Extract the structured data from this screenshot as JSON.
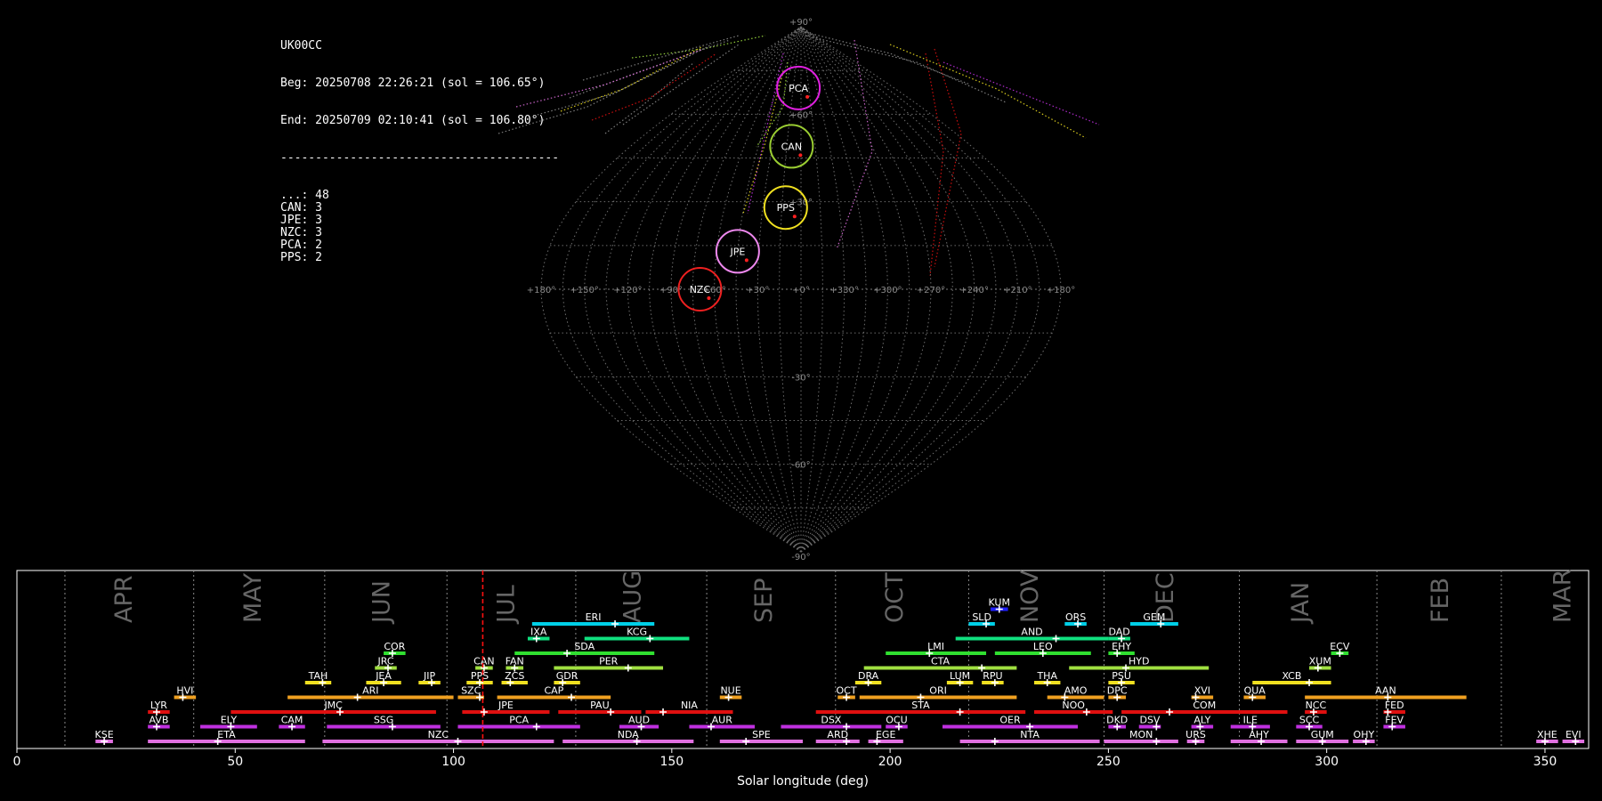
{
  "info": {
    "station": "UK00CC",
    "begin": "Beg: 20250708 22:26:21 (sol = 106.65°)",
    "end": "End: 20250709 02:10:41 (sol = 106.80°)",
    "separator": "----------------------------------------",
    "counts": [
      {
        "code": "...",
        "count": 48
      },
      {
        "code": "CAN",
        "count": 3
      },
      {
        "code": "JPE",
        "count": 3
      },
      {
        "code": "NZC",
        "count": 3
      },
      {
        "code": "PCA",
        "count": 2
      },
      {
        "code": "PPS",
        "count": 2
      }
    ]
  },
  "colors": {
    "PCA": "#e020e0",
    "CAN": "#9acd32",
    "PPS": "#f0e020",
    "JPE": "#ee88ee",
    "NZC": "#ee2020",
    "gray": "#888888",
    "red": "#e01010",
    "orange": "#f0a020",
    "yellow": "#f0e020",
    "green": "#a0e040",
    "lime": "#30e030",
    "cyan": "#00d0e8",
    "teal": "#10e080",
    "magenta": "#c030e0",
    "pink": "#e070e0",
    "blue": "#2020ff",
    "marker": "#ff2020"
  },
  "chart_data": [
    {
      "type": "scatter",
      "projection": "sinusoidal (radiant sky map)",
      "lon_ticks": [
        "+180°",
        "+150°",
        "+120°",
        "+90°",
        "+60°",
        "+30°",
        "+0°",
        "+330°",
        "+300°",
        "+270°",
        "+240°",
        "+210°",
        "+180°"
      ],
      "lat_ticks": [
        "+90°",
        "+60°",
        "+30°",
        "-30°",
        "-60°",
        "-90°"
      ],
      "radiants": [
        {
          "code": "PCA",
          "lon": -5,
          "lat": 69
        },
        {
          "code": "CAN",
          "lon": -10,
          "lat": 49
        },
        {
          "code": "PPS",
          "lon": -12,
          "lat": 28
        },
        {
          "code": "JPE",
          "lon": -45,
          "lat": 13
        },
        {
          "code": "NZC",
          "lon": -70,
          "lat": 0
        }
      ]
    },
    {
      "type": "bar",
      "xlabel": "Solar longitude (deg)",
      "xlim": [
        0,
        360
      ],
      "x_ticks": [
        0,
        50,
        100,
        150,
        200,
        250,
        300,
        350
      ],
      "current_sol": 106.7,
      "months": [
        {
          "label": "APR",
          "at": 24.5,
          "start": 11
        },
        {
          "label": "MAY",
          "at": 54,
          "start": 40.5
        },
        {
          "label": "JUN",
          "at": 83.5,
          "start": 70.5
        },
        {
          "label": "JUL",
          "at": 112,
          "start": 98.5
        },
        {
          "label": "AUG",
          "at": 141,
          "start": 128
        },
        {
          "label": "SEP",
          "at": 171,
          "start": 158
        },
        {
          "label": "OCT",
          "at": 201,
          "start": 187.5
        },
        {
          "label": "NOV",
          "at": 232,
          "start": 218
        },
        {
          "label": "DEC",
          "at": 263,
          "start": 249
        },
        {
          "label": "JAN",
          "at": 294,
          "start": 280
        },
        {
          "label": "FEB",
          "at": 326,
          "start": 311.5
        },
        {
          "label": "MAR",
          "at": 354,
          "start": 340
        }
      ],
      "showers": [
        {
          "code": "KUM",
          "start": 223,
          "end": 227,
          "peak": 225,
          "row": 9,
          "color": "blue"
        },
        {
          "code": "ERI",
          "start": 118,
          "end": 146,
          "peak": 137,
          "row": 8,
          "color": "cyan"
        },
        {
          "code": "SLD",
          "start": 218,
          "end": 224,
          "peak": 222,
          "row": 8,
          "color": "cyan"
        },
        {
          "code": "ORS",
          "start": 240,
          "end": 245,
          "peak": 243,
          "row": 8,
          "color": "cyan"
        },
        {
          "code": "GEM",
          "start": 255,
          "end": 266,
          "peak": 262,
          "row": 8,
          "color": "cyan"
        },
        {
          "code": "IXA",
          "start": 117,
          "end": 122,
          "peak": 119,
          "row": 7,
          "color": "teal"
        },
        {
          "code": "KCG",
          "start": 130,
          "end": 154,
          "peak": 145,
          "row": 7,
          "color": "teal"
        },
        {
          "code": "AND",
          "start": 215,
          "end": 250,
          "peak": 238,
          "row": 7,
          "color": "teal"
        },
        {
          "code": "DAD",
          "start": 250,
          "end": 255,
          "peak": 253,
          "row": 7,
          "color": "teal"
        },
        {
          "code": "COR",
          "start": 84,
          "end": 89,
          "peak": 86,
          "row": 6,
          "color": "lime"
        },
        {
          "code": "SDA",
          "start": 114,
          "end": 146,
          "peak": 126,
          "row": 6,
          "color": "lime"
        },
        {
          "code": "LMI",
          "start": 199,
          "end": 222,
          "peak": 209,
          "row": 6,
          "color": "lime"
        },
        {
          "code": "LEO",
          "start": 224,
          "end": 246,
          "peak": 235,
          "row": 6,
          "color": "lime"
        },
        {
          "code": "EHY",
          "start": 250,
          "end": 256,
          "peak": 252,
          "row": 6,
          "color": "lime"
        },
        {
          "code": "ECV",
          "start": 301,
          "end": 305,
          "peak": 303,
          "row": 6,
          "color": "lime"
        },
        {
          "code": "JRC",
          "start": 82,
          "end": 87,
          "peak": 85,
          "row": 5,
          "color": "green"
        },
        {
          "code": "CAN",
          "start": 105,
          "end": 109,
          "peak": 107,
          "row": 5,
          "color": "green"
        },
        {
          "code": "FAN",
          "start": 112,
          "end": 116,
          "peak": 114,
          "row": 5,
          "color": "green"
        },
        {
          "code": "PER",
          "start": 123,
          "end": 148,
          "peak": 140,
          "row": 5,
          "color": "green"
        },
        {
          "code": "CTA",
          "start": 194,
          "end": 229,
          "peak": 221,
          "row": 5,
          "color": "green"
        },
        {
          "code": "HYD",
          "start": 241,
          "end": 273,
          "peak": 254,
          "row": 5,
          "color": "green"
        },
        {
          "code": "XUM",
          "start": 296,
          "end": 301,
          "peak": 298,
          "row": 5,
          "color": "green"
        },
        {
          "code": "TAH",
          "start": 66,
          "end": 72,
          "peak": 70,
          "row": 4,
          "color": "yellow"
        },
        {
          "code": "JEA",
          "start": 80,
          "end": 88,
          "peak": 84,
          "row": 4,
          "color": "yellow"
        },
        {
          "code": "JIP",
          "start": 92,
          "end": 97,
          "peak": 95,
          "row": 4,
          "color": "yellow"
        },
        {
          "code": "PPS",
          "start": 103,
          "end": 109,
          "peak": 106,
          "row": 4,
          "color": "yellow"
        },
        {
          "code": "ZCS",
          "start": 111,
          "end": 117,
          "peak": 113,
          "row": 4,
          "color": "yellow"
        },
        {
          "code": "GDR",
          "start": 123,
          "end": 129,
          "peak": 125,
          "row": 4,
          "color": "yellow"
        },
        {
          "code": "DRA",
          "start": 192,
          "end": 198,
          "peak": 195,
          "row": 4,
          "color": "yellow"
        },
        {
          "code": "LUM",
          "start": 213,
          "end": 219,
          "peak": 216,
          "row": 4,
          "color": "yellow"
        },
        {
          "code": "RPU",
          "start": 221,
          "end": 226,
          "peak": 224,
          "row": 4,
          "color": "yellow"
        },
        {
          "code": "THA",
          "start": 233,
          "end": 239,
          "peak": 236,
          "row": 4,
          "color": "yellow"
        },
        {
          "code": "PSU",
          "start": 250,
          "end": 256,
          "peak": 253,
          "row": 4,
          "color": "yellow"
        },
        {
          "code": "XCB",
          "start": 283,
          "end": 301,
          "peak": 296,
          "row": 4,
          "color": "yellow"
        },
        {
          "code": "HVI",
          "start": 36,
          "end": 41,
          "peak": 38,
          "row": 3,
          "color": "orange"
        },
        {
          "code": "ARI",
          "start": 62,
          "end": 100,
          "peak": 78,
          "row": 3,
          "color": "orange"
        },
        {
          "code": "SZC",
          "start": 101,
          "end": 107,
          "peak": 106,
          "row": 3,
          "color": "orange"
        },
        {
          "code": "CAP",
          "start": 110,
          "end": 136,
          "peak": 127,
          "row": 3,
          "color": "orange"
        },
        {
          "code": "NUE",
          "start": 161,
          "end": 166,
          "peak": 163,
          "row": 3,
          "color": "orange"
        },
        {
          "code": "OCT",
          "start": 188,
          "end": 192,
          "peak": 190,
          "row": 3,
          "color": "orange"
        },
        {
          "code": "ORI",
          "start": 193,
          "end": 229,
          "peak": 207,
          "row": 3,
          "color": "orange"
        },
        {
          "code": "AMO",
          "start": 236,
          "end": 249,
          "peak": 240,
          "row": 3,
          "color": "orange"
        },
        {
          "code": "DPC",
          "start": 250,
          "end": 254,
          "peak": 252,
          "row": 3,
          "color": "orange"
        },
        {
          "code": "XVI",
          "start": 269,
          "end": 274,
          "peak": 270,
          "row": 3,
          "color": "orange"
        },
        {
          "code": "QUA",
          "start": 281,
          "end": 286,
          "peak": 283,
          "row": 3,
          "color": "orange"
        },
        {
          "code": "AAN",
          "start": 295,
          "end": 332,
          "peak": 314,
          "row": 3,
          "color": "orange"
        },
        {
          "code": "LYR",
          "start": 30,
          "end": 35,
          "peak": 32,
          "row": 2,
          "color": "red"
        },
        {
          "code": "JMC",
          "start": 49,
          "end": 96,
          "peak": 74,
          "row": 2,
          "color": "red"
        },
        {
          "code": "JPE",
          "start": 102,
          "end": 122,
          "peak": 107,
          "row": 2,
          "color": "red"
        },
        {
          "code": "PAU",
          "start": 124,
          "end": 143,
          "peak": 136,
          "row": 2,
          "color": "red"
        },
        {
          "code": "NIA",
          "start": 144,
          "end": 164,
          "peak": 148,
          "row": 2,
          "color": "red"
        },
        {
          "code": "STA",
          "start": 183,
          "end": 231,
          "peak": 216,
          "row": 2,
          "color": "red"
        },
        {
          "code": "NOO",
          "start": 233,
          "end": 251,
          "peak": 245,
          "row": 2,
          "color": "red"
        },
        {
          "code": "COM",
          "start": 253,
          "end": 291,
          "peak": 264,
          "row": 2,
          "color": "red"
        },
        {
          "code": "NCC",
          "start": 295,
          "end": 300,
          "peak": 297,
          "row": 2,
          "color": "red"
        },
        {
          "code": "FED",
          "start": 313,
          "end": 318,
          "peak": 314,
          "row": 2,
          "color": "red"
        },
        {
          "code": "AVB",
          "start": 30,
          "end": 35,
          "peak": 32,
          "row": 1,
          "color": "magenta"
        },
        {
          "code": "ELY",
          "start": 42,
          "end": 55,
          "peak": 49,
          "row": 1,
          "color": "magenta"
        },
        {
          "code": "CAM",
          "start": 60,
          "end": 66,
          "peak": 63,
          "row": 1,
          "color": "magenta"
        },
        {
          "code": "SSG",
          "start": 71,
          "end": 97,
          "peak": 86,
          "row": 1,
          "color": "magenta"
        },
        {
          "code": "PCA",
          "start": 101,
          "end": 129,
          "peak": 119,
          "row": 1,
          "color": "magenta"
        },
        {
          "code": "AUD",
          "start": 138,
          "end": 147,
          "peak": 143,
          "row": 1,
          "color": "magenta"
        },
        {
          "code": "AUR",
          "start": 154,
          "end": 169,
          "peak": 159,
          "row": 1,
          "color": "magenta"
        },
        {
          "code": "DSX",
          "start": 175,
          "end": 198,
          "peak": 190,
          "row": 1,
          "color": "magenta"
        },
        {
          "code": "OCU",
          "start": 199,
          "end": 204,
          "peak": 202,
          "row": 1,
          "color": "magenta"
        },
        {
          "code": "OER",
          "start": 212,
          "end": 243,
          "peak": 232,
          "row": 1,
          "color": "magenta"
        },
        {
          "code": "DKD",
          "start": 250,
          "end": 254,
          "peak": 252,
          "row": 1,
          "color": "magenta"
        },
        {
          "code": "DSV",
          "start": 257,
          "end": 262,
          "peak": 261,
          "row": 1,
          "color": "magenta"
        },
        {
          "code": "ALY",
          "start": 269,
          "end": 274,
          "peak": 271,
          "row": 1,
          "color": "magenta"
        },
        {
          "code": "ILE",
          "start": 278,
          "end": 287,
          "peak": 283,
          "row": 1,
          "color": "magenta"
        },
        {
          "code": "SCC",
          "start": 293,
          "end": 299,
          "peak": 296,
          "row": 1,
          "color": "magenta"
        },
        {
          "code": "FEV",
          "start": 313,
          "end": 318,
          "peak": 315,
          "row": 1,
          "color": "magenta"
        },
        {
          "code": "KSE",
          "start": 18,
          "end": 22,
          "peak": 20,
          "row": 0,
          "color": "pink"
        },
        {
          "code": "ETA",
          "start": 30,
          "end": 66,
          "peak": 46,
          "row": 0,
          "color": "pink"
        },
        {
          "code": "NZC",
          "start": 70,
          "end": 123,
          "peak": 101,
          "row": 0,
          "color": "pink"
        },
        {
          "code": "NDA",
          "start": 125,
          "end": 155,
          "peak": 142,
          "row": 0,
          "color": "pink"
        },
        {
          "code": "SPE",
          "start": 161,
          "end": 180,
          "peak": 167,
          "row": 0,
          "color": "pink"
        },
        {
          "code": "ARD",
          "start": 183,
          "end": 193,
          "peak": 190,
          "row": 0,
          "color": "pink"
        },
        {
          "code": "EGE",
          "start": 195,
          "end": 203,
          "peak": 197,
          "row": 0,
          "color": "pink"
        },
        {
          "code": "NTA",
          "start": 216,
          "end": 248,
          "peak": 224,
          "row": 0,
          "color": "pink"
        },
        {
          "code": "MON",
          "start": 249,
          "end": 266,
          "peak": 261,
          "row": 0,
          "color": "pink"
        },
        {
          "code": "URS",
          "start": 268,
          "end": 272,
          "peak": 270,
          "row": 0,
          "color": "pink"
        },
        {
          "code": "AHY",
          "start": 278,
          "end": 291,
          "peak": 285,
          "row": 0,
          "color": "pink"
        },
        {
          "code": "GUM",
          "start": 293,
          "end": 305,
          "peak": 299,
          "row": 0,
          "color": "pink"
        },
        {
          "code": "OHY",
          "start": 306,
          "end": 311,
          "peak": 309,
          "row": 0,
          "color": "pink"
        },
        {
          "code": "XHE",
          "start": 348,
          "end": 353,
          "peak": 350,
          "row": 0,
          "color": "pink"
        },
        {
          "code": "EVI",
          "start": 354,
          "end": 359,
          "peak": 357,
          "row": 0,
          "color": "pink"
        }
      ]
    }
  ]
}
